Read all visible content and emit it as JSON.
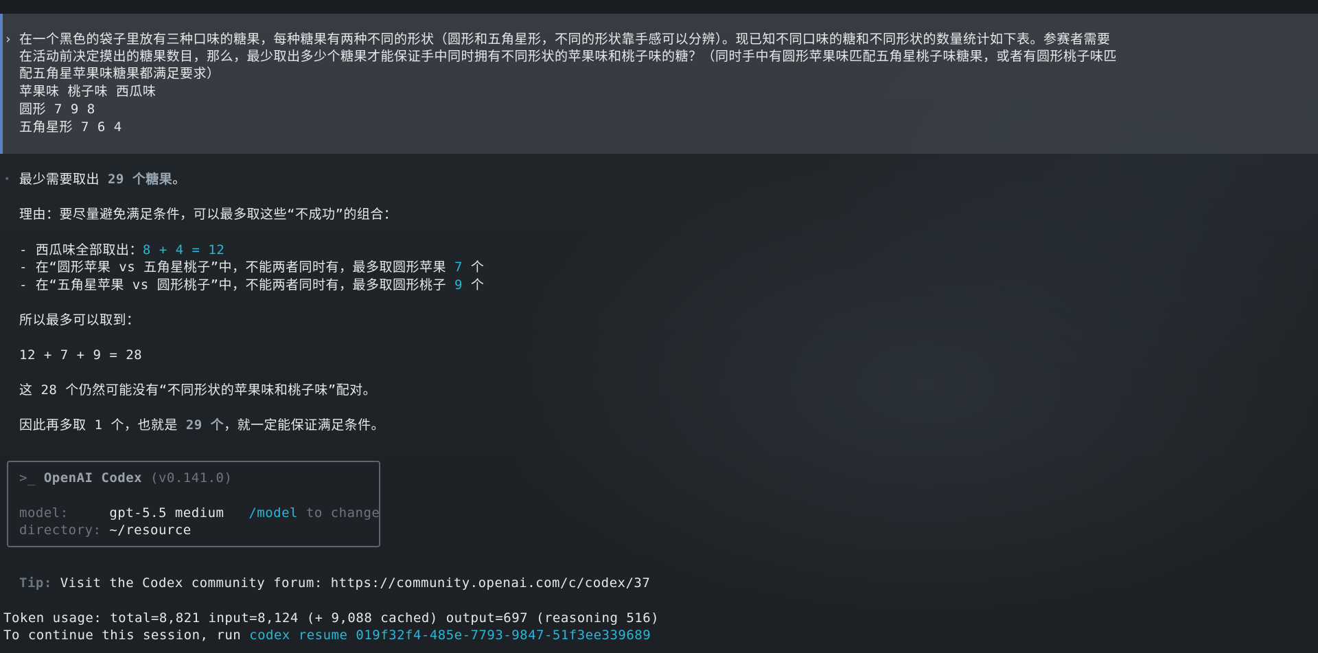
{
  "user_prompt": {
    "caret": "›",
    "lines": [
      "在一个黑色的袋子里放有三种口味的糖果，每种糖果有两种不同的形状（圆形和五角星形，不同的形状靠手感可以分辨）。现已知不同口味的糖和不同形状的数量统计如下表。参赛者需要",
      "在活动前决定摸出的糖果数目，那么，最少取出多少个糖果才能保证手中同时拥有不同形状的苹果味和桃子味的糖？（同时手中有圆形苹果味匹配五角星桃子味糖果，或者有圆形桃子味匹",
      "配五角星苹果味糖果都满足要求）",
      "苹果味 桃子味 西瓜味",
      "圆形 7 9 8",
      "五角星形 7 6 4"
    ]
  },
  "answer": {
    "bullet": "•",
    "l1_pre": "最少需要取出 ",
    "l1_num": "29 个糖果",
    "l1_post": "。",
    "l2": "理由：要尽量避免满足条件，可以最多取这些“不成功”的组合：",
    "l3_pre": "- 西瓜味全部取出：",
    "l3_expr": "8 + 4 = 12",
    "l4_pre": "- 在“圆形苹果 vs 五角星桃子”中，不能两者同时有，最多取圆形苹果 ",
    "l4_num": "7",
    "l4_post": " 个",
    "l5_pre": "- 在“五角星苹果 vs 圆形桃子”中，不能两者同时有，最多取圆形桃子 ",
    "l5_num": "9",
    "l5_post": " 个",
    "l6": "所以最多可以取到：",
    "l7": "12 + 7 + 9 = 28",
    "l8": "这 28 个仍然可能没有“不同形状的苹果味和桃子味”配对。",
    "l9_pre": "因此再多取 1 个，也就是 ",
    "l9_num": "29 个",
    "l9_post": "，就一定能保证满足条件。"
  },
  "codex_box": {
    "prompt_symbol": ">_ ",
    "product": "OpenAI Codex",
    "version": " (v0.141.0)",
    "model_label": "model:     ",
    "model_value": "gpt-5.5 medium",
    "model_cmd": "/model",
    "model_hint": " to change",
    "dir_label": "directory: ",
    "dir_value": "~/resource"
  },
  "tip": {
    "label": "Tip:",
    "text": " Visit the Codex community forum: https://community.openai.com/c/codex/37"
  },
  "footer": {
    "usage": "Token usage: total=8,821 input=8,124 (+ 9,088 cached) output=697 (reasoning 516)",
    "continue_pre": "To continue this session, run ",
    "continue_cmd": "codex resume 019f32f4-485e-7793-9847-51f3ee339689"
  },
  "colors": {
    "accent_cyan": "#27b8d8",
    "prompt_bar": "#5a82c8",
    "background": "#1e2226"
  }
}
